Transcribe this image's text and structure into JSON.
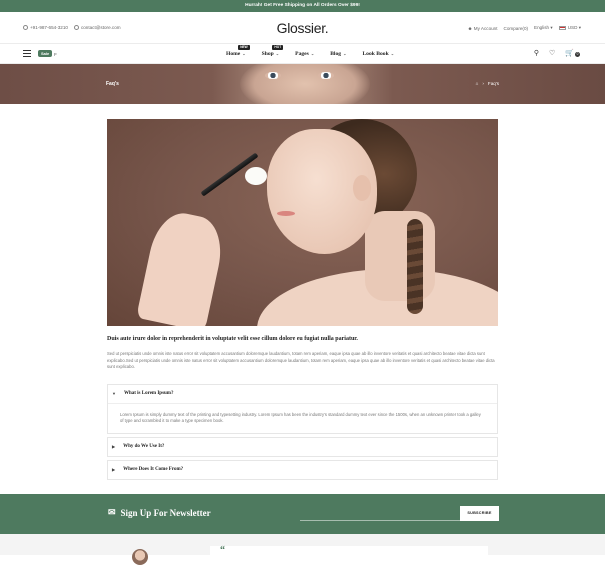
{
  "topbar": {
    "text": "Hurrah! Get Free Shipping on All Orders Over $99!"
  },
  "header": {
    "phone": "+91-987-654-3210",
    "email": "contact@store.com",
    "logo": "Glossier.",
    "account": "My Account",
    "compare": "Compare(0)",
    "language": "English",
    "currency": "USD"
  },
  "nav": {
    "promo_tag": "Sale",
    "promo_text": "p",
    "items": [
      {
        "label": "Home",
        "badge": "NEW"
      },
      {
        "label": "Shop",
        "badge": "HOT"
      },
      {
        "label": "Pages",
        "badge": ""
      },
      {
        "label": "Blog",
        "badge": ""
      },
      {
        "label": "Look Book",
        "badge": ""
      }
    ],
    "cart_count": "0"
  },
  "hero": {
    "title": "Faq's",
    "breadcrumb_current": "Faq's"
  },
  "content": {
    "lead": "Duis aute irure dolor in reprehenderit in voluptate velit esse cillum dolore eu fugiat nulla pariatur.",
    "paragraph": "Sed ut perspiciatis unde omnis iste natus error sit voluptatem accusantium doloremque laudantium, totam rem aperiam, eaque ipsa quae ab illo inventore veritatis et quasi architecto beatae vitae dicta sunt explicabo.Sed ut perspiciatis unde omnis iste natus error sit voluptatem accusantium doloremque laudantium, totam rem aperiam, eaque ipsa quae ab illo inventore veritatis et quasi architecto beatae vitae dicta sunt explicabo."
  },
  "faq": [
    {
      "question": "What is Lorem Ipsum?",
      "answer": "Lorem Ipsum is simply dummy text of the printing and typesetting industry. Lorem Ipsum has been the industry's standard dummy text ever since the 1500s, when an unknown printer took a galley of type and scrambled it to make a type specimen book.",
      "open": true
    },
    {
      "question": "Why do We Use It?",
      "answer": "",
      "open": false
    },
    {
      "question": "Where Does It Come From?",
      "answer": "",
      "open": false
    }
  ],
  "newsletter": {
    "title": "Sign Up For Newsletter",
    "button": "SUBSCRIBE"
  },
  "colors": {
    "accent": "#4e7a5f",
    "hero": "#7c5a50"
  }
}
